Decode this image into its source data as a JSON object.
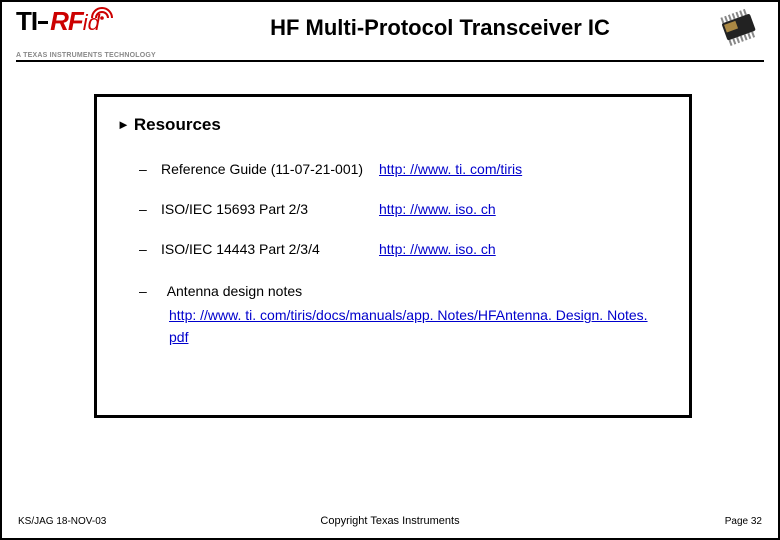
{
  "header": {
    "title": "HF Multi-Protocol Transceiver IC",
    "logo_text_ti": "TI",
    "logo_text_rf": "RF",
    "logo_text_id": "id",
    "logo_sub": "A TEXAS INSTRUMENTS TECHNOLOGY"
  },
  "section": {
    "marker": "►",
    "title": "Resources"
  },
  "items": [
    {
      "label": "Reference Guide (11-07-21-001)",
      "url": "http: //www. ti. com/tiris"
    },
    {
      "label": "ISO/IEC 15693 Part 2/3",
      "url": "http: //www. iso. ch"
    },
    {
      "label": "ISO/IEC 14443 Part 2/3/4",
      "url": "http: //www. iso. ch"
    }
  ],
  "long_item": {
    "label": "Antenna design notes",
    "url": "http: //www. ti. com/tiris/docs/manuals/app. Notes/HFAntenna. Design. Notes. pdf"
  },
  "footer": {
    "left": "KS/JAG 18-NOV-03",
    "center": "Copyright Texas Instruments",
    "right": "Page 32"
  }
}
